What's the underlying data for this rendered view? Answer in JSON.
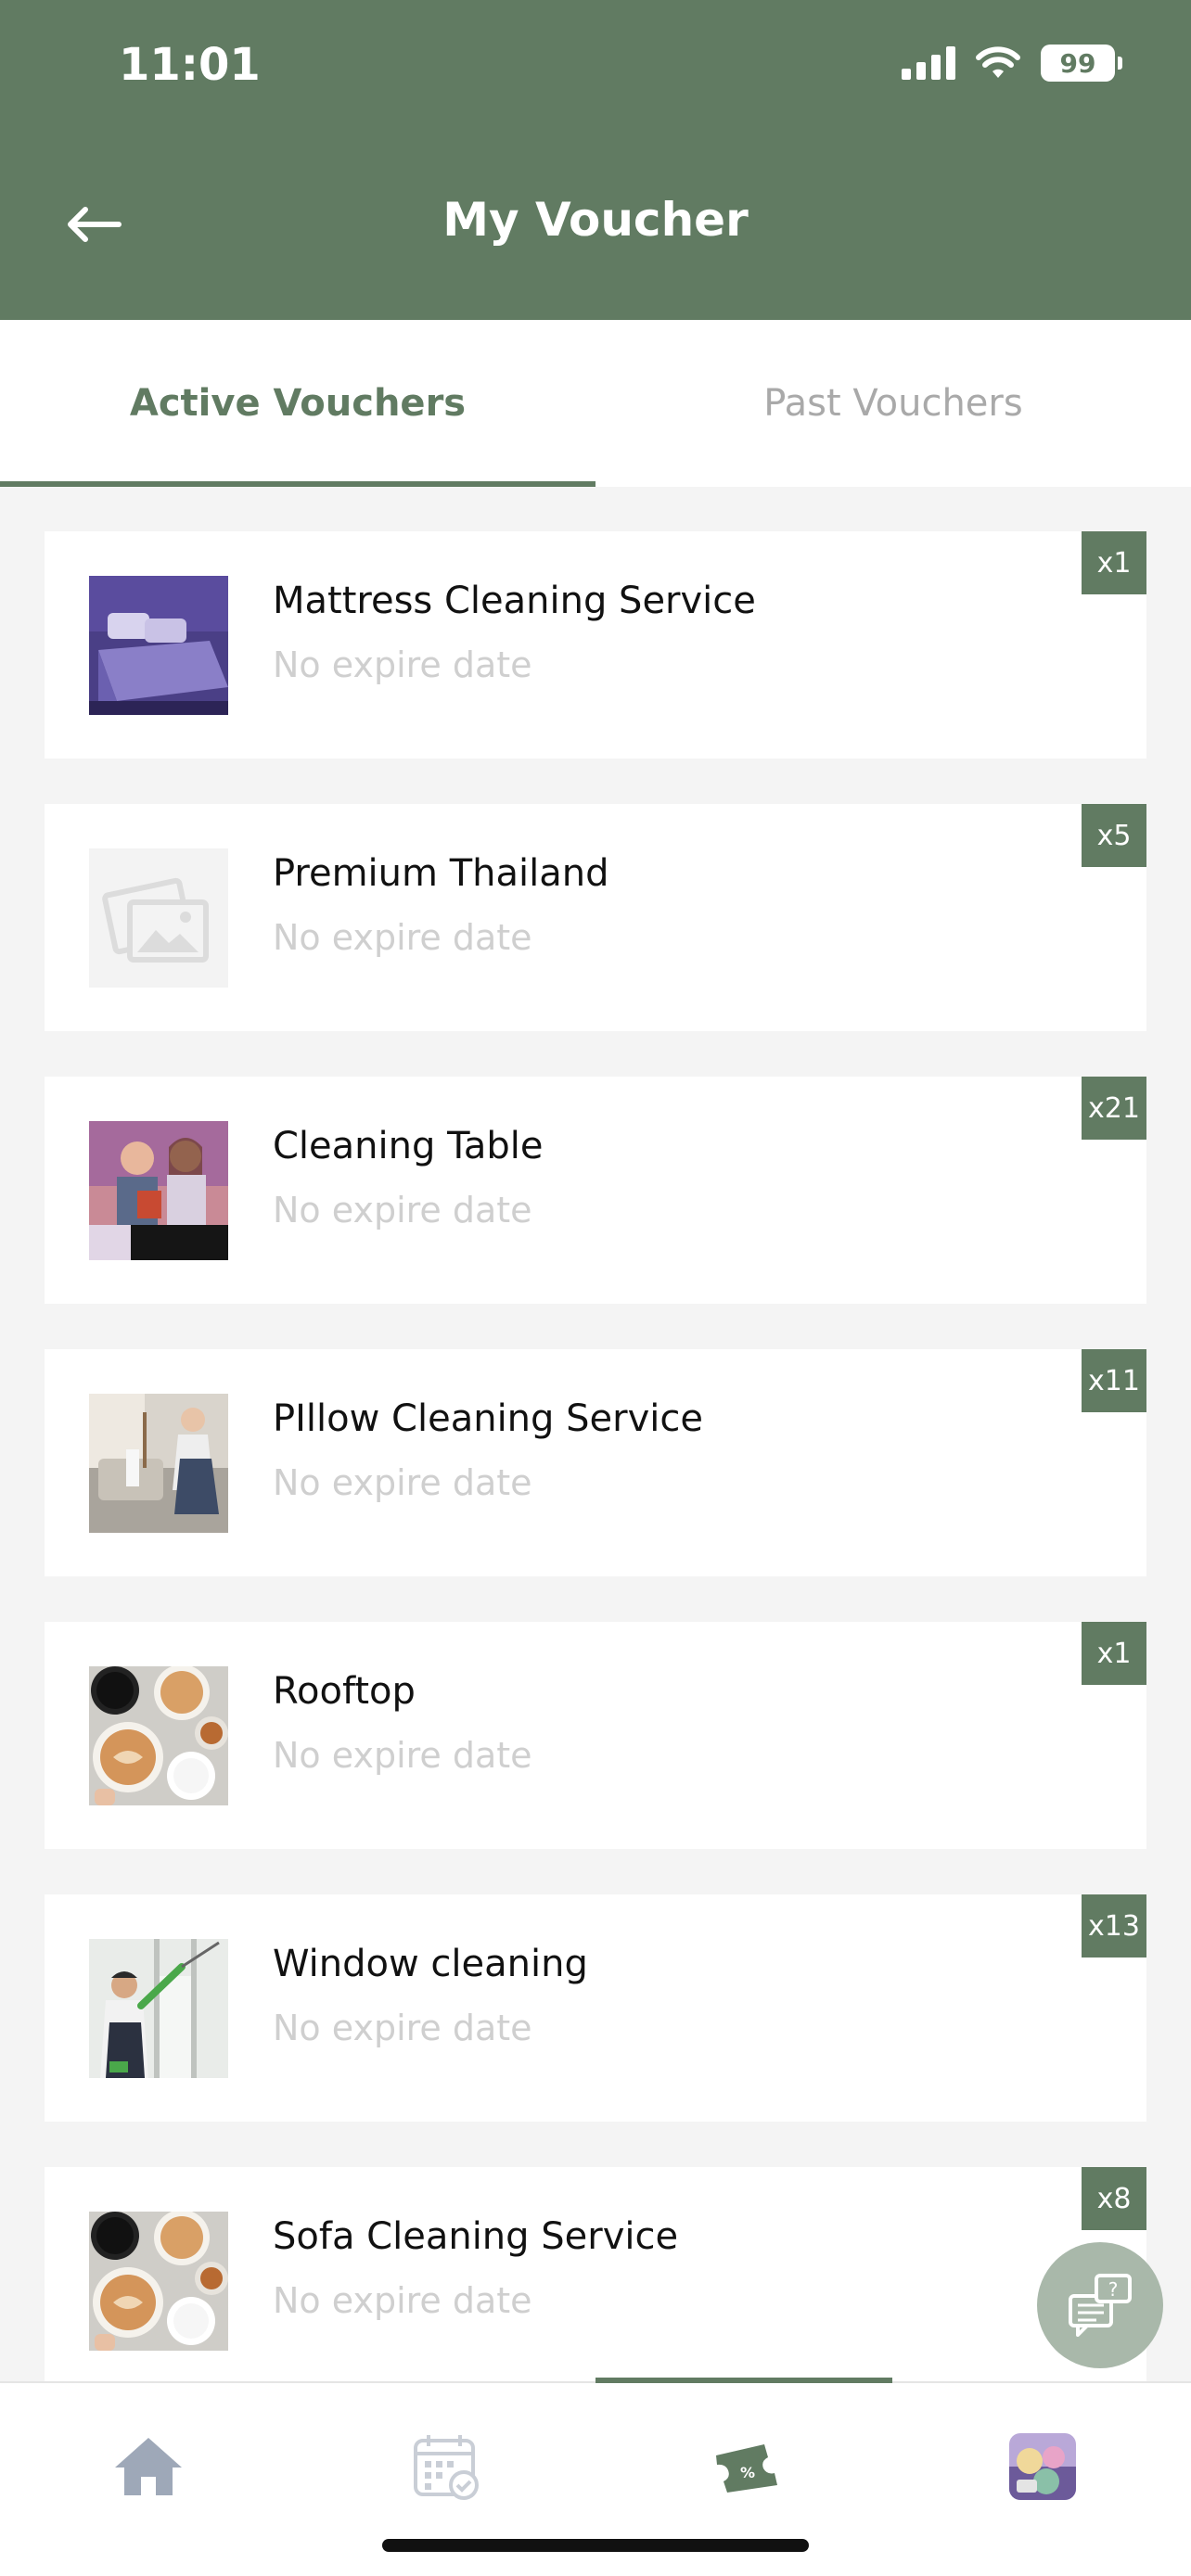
{
  "status_bar": {
    "time": "11:01",
    "battery": "99"
  },
  "header": {
    "title": "My Voucher"
  },
  "tabs": [
    {
      "label": "Active Vouchers",
      "active": true
    },
    {
      "label": "Past Vouchers",
      "active": false
    }
  ],
  "vouchers": [
    {
      "name": "Mattress Cleaning Service",
      "expire": "No expire date",
      "qty": "x1",
      "image": "bed-photo"
    },
    {
      "name": "Premium Thailand",
      "expire": "No expire date",
      "qty": "x5",
      "image": "placeholder-image-icon"
    },
    {
      "name": "Cleaning Table",
      "expire": "No expire date",
      "qty": "x21",
      "image": "people-photo"
    },
    {
      "name": "PIllow Cleaning Service",
      "expire": "No expire date",
      "qty": "x11",
      "image": "living-room-photo"
    },
    {
      "name": "Rooftop",
      "expire": "No expire date",
      "qty": "x1",
      "image": "coffee-photo"
    },
    {
      "name": "Window cleaning",
      "expire": "No expire date",
      "qty": "x13",
      "image": "window-cleaner-photo"
    },
    {
      "name": "Sofa Cleaning Service",
      "expire": "No expire date",
      "qty": "x8",
      "image": "coffee-photo"
    }
  ],
  "nav": [
    "home-icon",
    "calendar-check-icon",
    "voucher-ticket-icon",
    "profile-avatar"
  ],
  "colors": {
    "brand": "#617b62",
    "inactive_tab": "#a9a9a9",
    "expire_text": "#cfcfcf"
  }
}
